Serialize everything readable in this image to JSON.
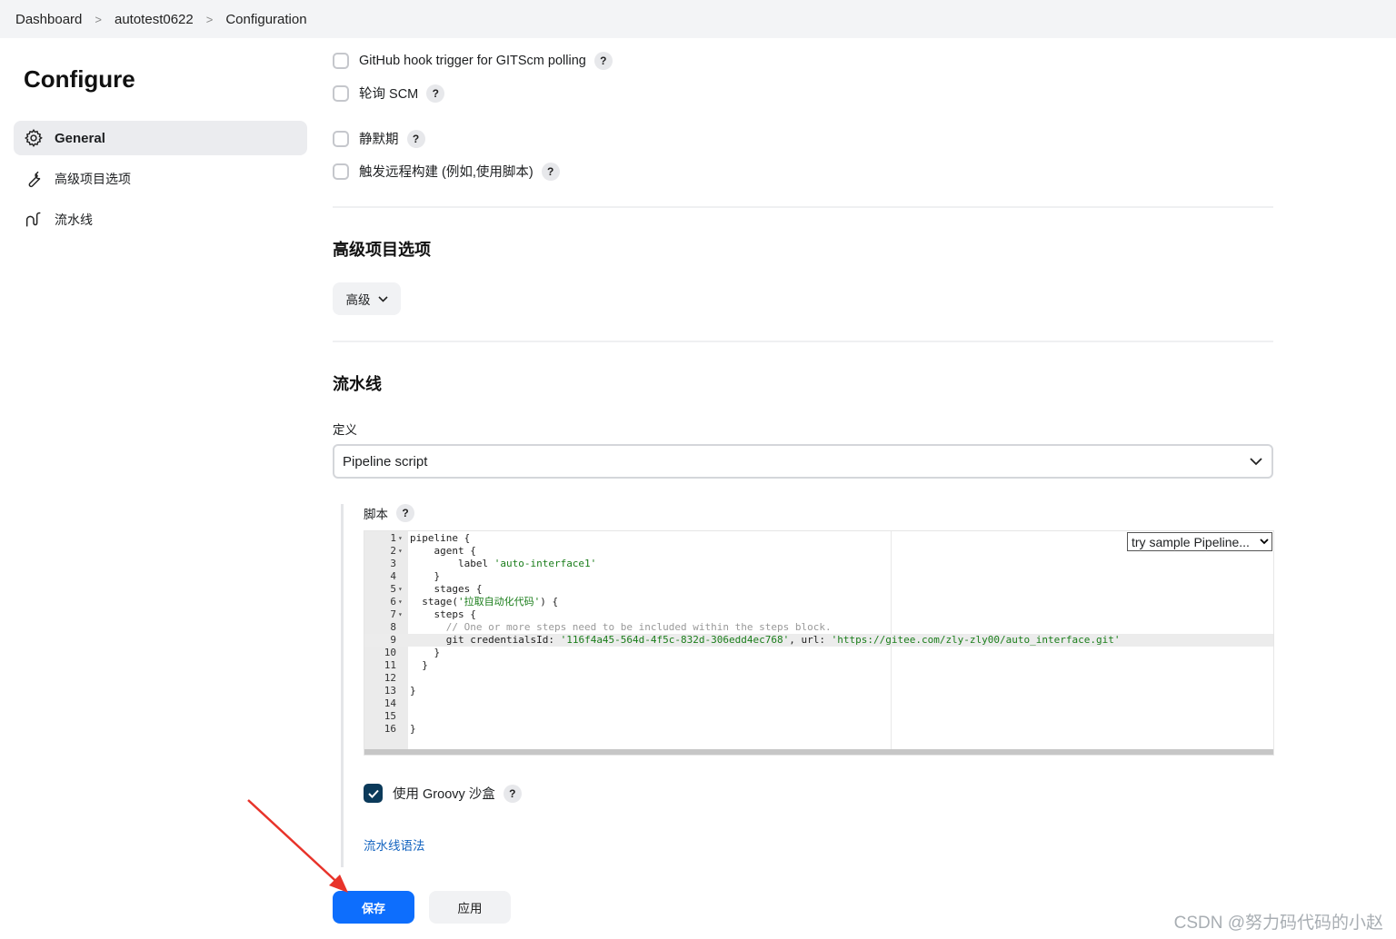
{
  "breadcrumb": [
    "Dashboard",
    "autotest0622",
    "Configuration"
  ],
  "sidebar": {
    "title": "Configure",
    "items": [
      {
        "label": "General",
        "icon": "gear-icon",
        "active": true
      },
      {
        "label": "高级项目选项",
        "icon": "wrench-icon",
        "active": false
      },
      {
        "label": "流水线",
        "icon": "pipeline-icon",
        "active": false
      }
    ]
  },
  "triggers": [
    {
      "label": "GitHub hook trigger for GITScm polling",
      "checked": false
    },
    {
      "label": "轮询 SCM",
      "checked": false
    },
    {
      "label": "静默期",
      "checked": false
    },
    {
      "label": "触发远程构建 (例如,使用脚本)",
      "checked": false
    }
  ],
  "advanced": {
    "title": "高级项目选项",
    "button_label": "高级"
  },
  "pipeline": {
    "title": "流水线",
    "definition_label": "定义",
    "definition_value": "Pipeline script",
    "script_label": "脚本",
    "sample_select": "try sample Pipeline...",
    "groovy_sandbox_label": "使用 Groovy 沙盒",
    "groovy_sandbox_checked": true,
    "syntax_link": "流水线语法",
    "code_lines": [
      "pipeline {",
      "    agent {",
      "        label 'auto-interface1'",
      "    }",
      "    stages {",
      "  stage('拉取自动化代码') {",
      "    steps {",
      "      // One or more steps need to be included within the steps block.",
      "      git credentialsId: '116f4a45-564d-4f5c-832d-306edd4ec768', url: 'https://gitee.com/zly-zly00/auto_interface.git'",
      "    }",
      "  }",
      "",
      "}",
      "",
      "",
      "}"
    ],
    "highlighted_line": 9
  },
  "buttons": {
    "save": "保存",
    "apply": "应用"
  },
  "help_glyph": "?",
  "watermark": "CSDN @努力码代码的小赵",
  "colors": {
    "primary": "#0d6efd",
    "checkbox_checked": "#0b3a5a",
    "link": "#1565c0",
    "arrow": "#e8332a"
  }
}
